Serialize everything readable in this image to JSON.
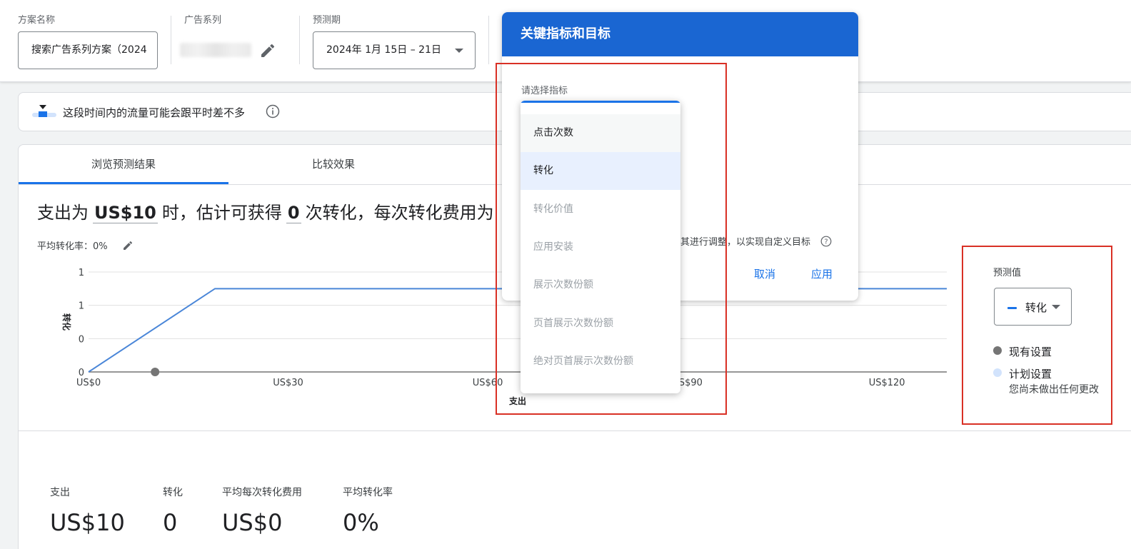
{
  "header": {
    "plan_name_label": "方案名称",
    "plan_name_value": "搜索广告系列方案（2024",
    "campaign_label": "广告系列",
    "period_label": "预测期",
    "period_value": "2024年 1月 15日 – 21日"
  },
  "banner": {
    "text": "这段时间内的流量可能会跟平时差不多"
  },
  "tabs": [
    {
      "label": "浏览预测结果",
      "active": true
    },
    {
      "label": "比较效果",
      "active": false
    }
  ],
  "headline": {
    "part1": "支出为",
    "spend": "US$10",
    "part2": "时，估计可获得",
    "conversions": "0",
    "part3": "次转化，每次转化费用为"
  },
  "avg_conversion_rate_label": "平均转化率：0%",
  "chart_data": {
    "type": "line",
    "xlabel": "支出",
    "ylabel": "转化",
    "x_tick_labels": [
      "US$0",
      "US$30",
      "US$60",
      "US$90",
      "US$120"
    ],
    "x_tick_values": [
      0,
      30,
      60,
      90,
      120
    ],
    "y_tick_labels": [
      "0",
      "0",
      "1",
      "1"
    ],
    "y_tick_values": [
      0,
      0.5,
      1.0,
      1.5
    ],
    "xlim": [
      0,
      129
    ],
    "ylim": [
      0,
      1.5
    ],
    "series": [
      {
        "x": [
          0,
          19,
          129
        ],
        "y": [
          0,
          1.25,
          1.25
        ],
        "color": "#4a86d8"
      }
    ],
    "current_point": {
      "x": 10,
      "y": 0,
      "color": "#757575"
    },
    "grid": true
  },
  "stats": [
    {
      "label": "支出",
      "value": "US$10"
    },
    {
      "label": "转化",
      "value": "0"
    },
    {
      "label": "平均每次转化费用",
      "value": "US$0"
    },
    {
      "label": "平均转化率",
      "value": "0%"
    }
  ],
  "forecast_panel": {
    "title": "预测值",
    "selected": "转化",
    "legend": [
      {
        "label": "现有设置",
        "color": "#757575"
      },
      {
        "label": "计划设置",
        "color": "#d2e3fc"
      }
    ],
    "note": "您尚未做出任何更改"
  },
  "dialog": {
    "title": "关键指标和目标",
    "select_label": "请选择指标",
    "hint": "其进行调整，以实现自定义目标",
    "cancel": "取消",
    "apply": "应用"
  },
  "dropdown": {
    "items": [
      {
        "label": "点击次数",
        "enabled": true
      },
      {
        "label": "转化",
        "enabled": true
      },
      {
        "label": "转化价值",
        "enabled": false
      },
      {
        "label": "应用安装",
        "enabled": false
      },
      {
        "label": "展示次数份额",
        "enabled": false
      },
      {
        "label": "页首展示次数份额",
        "enabled": false
      },
      {
        "label": "绝对页首展示次数份额",
        "enabled": false
      }
    ]
  },
  "colors": {
    "primary": "#1a73e8",
    "dialog_header": "#1a66d2",
    "annotation_red": "#d93025"
  }
}
